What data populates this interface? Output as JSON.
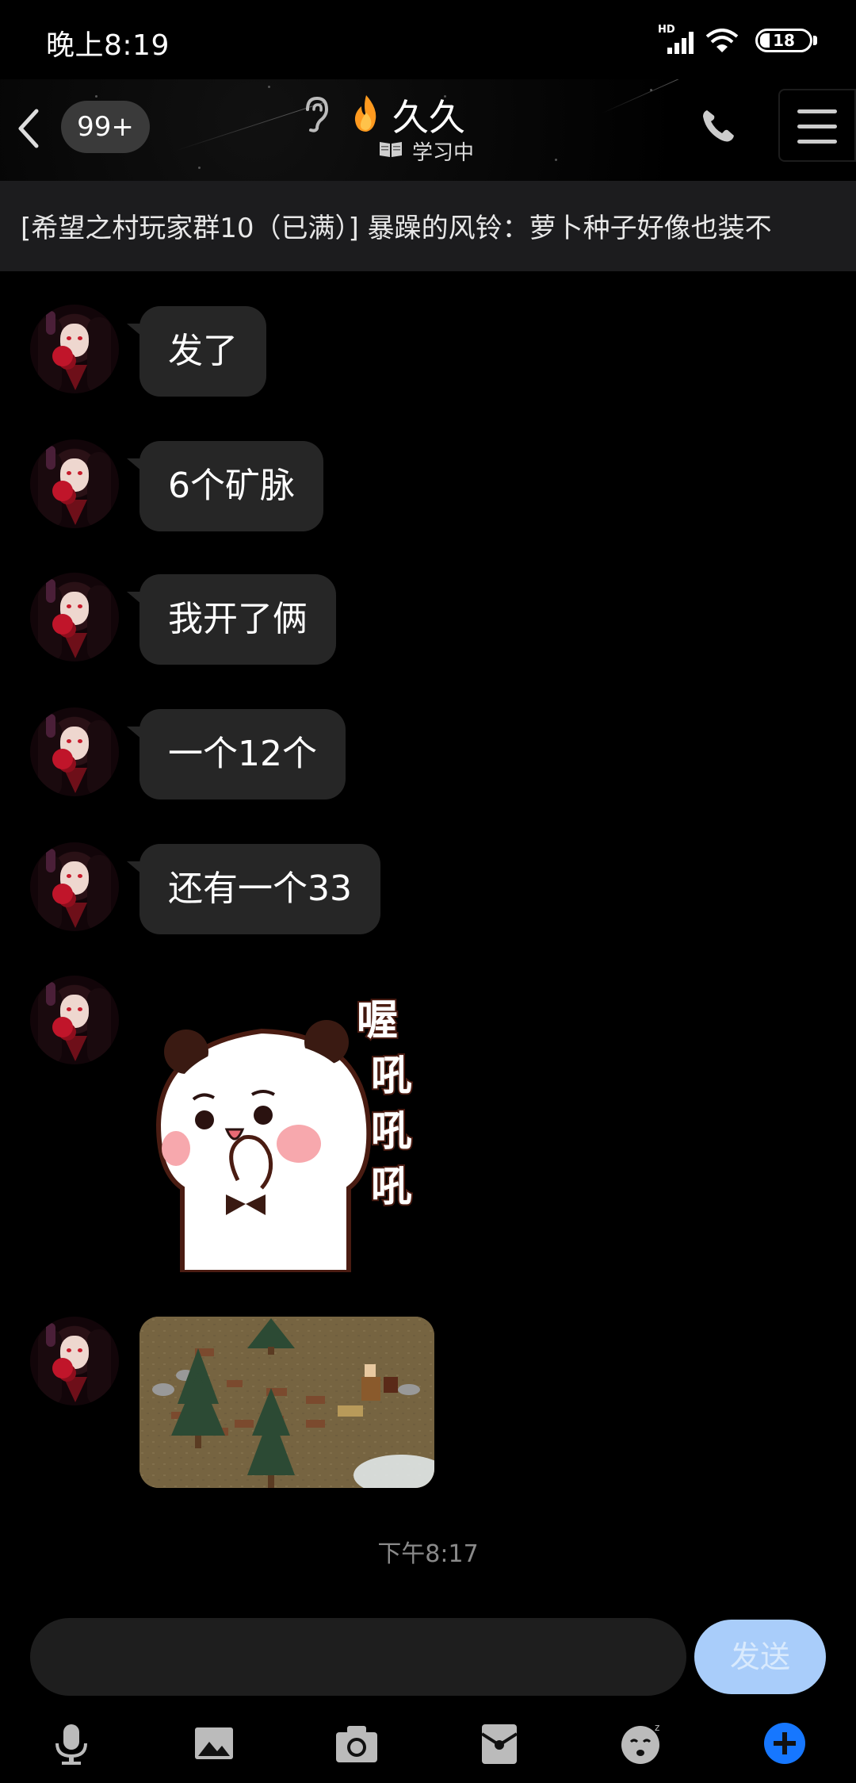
{
  "status_bar": {
    "time": "晚上8:19",
    "network": "HD",
    "battery": "18"
  },
  "header": {
    "unread_badge": "99+",
    "contact_name": "久久",
    "contact_status": "学习中"
  },
  "notice": {
    "text": "[希望之村玩家群10（已满）] 暴躁的风铃：萝卜种子好像也装不"
  },
  "messages": [
    {
      "type": "text",
      "text": "发了"
    },
    {
      "type": "text",
      "text": "6个矿脉"
    },
    {
      "type": "text",
      "text": "我开了俩"
    },
    {
      "type": "text",
      "text": "一个12个"
    },
    {
      "type": "text",
      "text": "还有一个33"
    },
    {
      "type": "sticker",
      "sticker_text": [
        "喔",
        "吼",
        "吼",
        "吼"
      ]
    },
    {
      "type": "image",
      "icon": "game-screenshot"
    }
  ],
  "timestamp": "下午8:17",
  "input": {
    "value": "",
    "send_label": "发送"
  },
  "toolbar": {
    "icons": [
      "microphone-icon",
      "image-icon",
      "camera-icon",
      "red-envelope-icon",
      "emoji-icon",
      "plus-icon"
    ]
  },
  "colors": {
    "background": "#000000",
    "bubble": "#262626",
    "send_button": "#a9cdfa",
    "plus_button": "#1677ff"
  }
}
